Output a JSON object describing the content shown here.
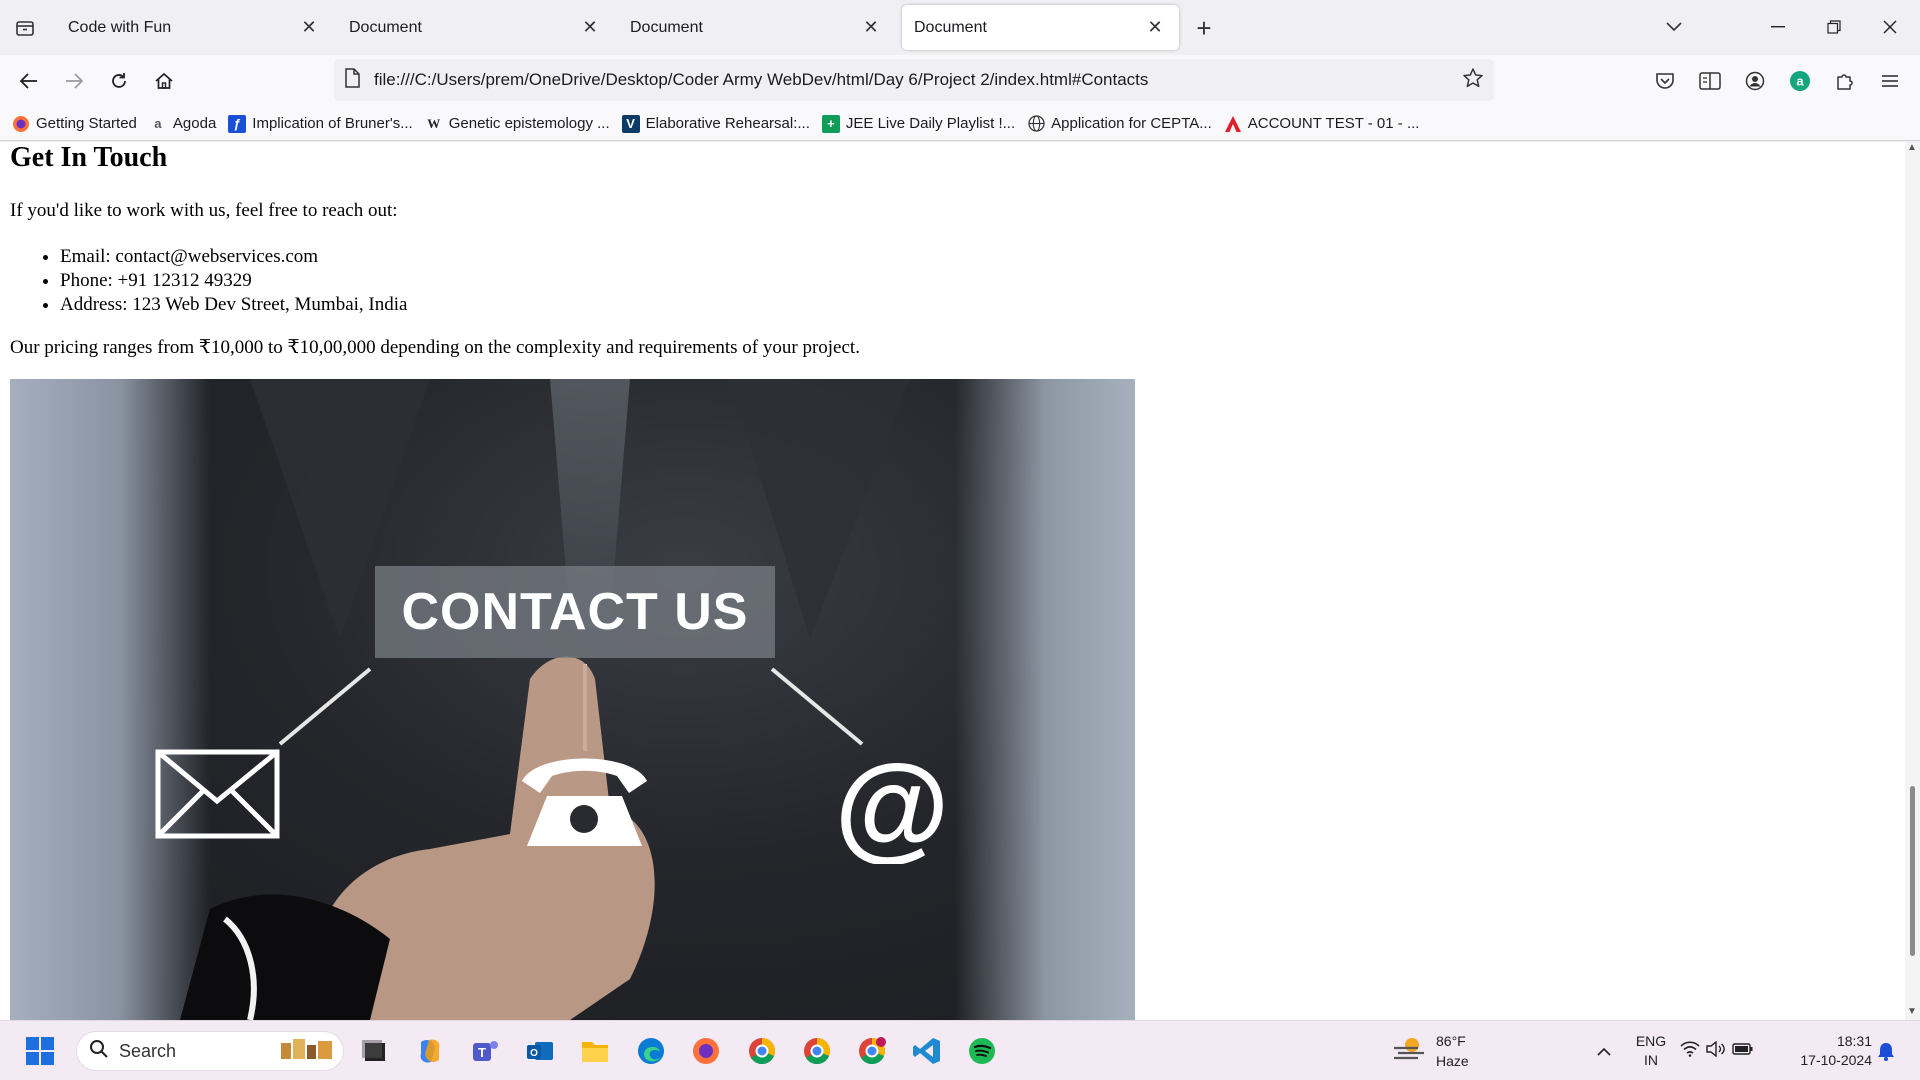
{
  "browser": {
    "tabs": [
      {
        "title": "Code with Fun",
        "active": false
      },
      {
        "title": "Document",
        "active": false
      },
      {
        "title": "Document",
        "active": false
      },
      {
        "title": "Document",
        "active": true
      }
    ],
    "url": "file:///C:/Users/prem/OneDrive/Desktop/Coder Army WebDev/html/Day 6/Project 2/index.html#Contacts",
    "bookmarks": [
      {
        "label": "Getting Started",
        "icon": "firefox-icon"
      },
      {
        "label": "Agoda",
        "icon": "agoda-icon"
      },
      {
        "label": "Implication of Bruner's...",
        "icon": "document-icon"
      },
      {
        "label": "Genetic epistemology ...",
        "icon": "wikipedia-icon"
      },
      {
        "label": "Elaborative Rehearsal:...",
        "icon": "v-icon"
      },
      {
        "label": "JEE Live Daily Playlist !...",
        "icon": "sheets-icon"
      },
      {
        "label": "Application for CEPTA...",
        "icon": "globe-icon"
      },
      {
        "label": "ACCOUNT TEST - 01 - ...",
        "icon": "a-red-icon"
      }
    ],
    "accent": "#0060df"
  },
  "page": {
    "heading": "Get In Touch",
    "intro": "If you'd like to work with us, feel free to reach out:",
    "contacts": [
      "Email: contact@webservices.com",
      "Phone: +91 12312 49329",
      "Address: 123 Web Dev Street, Mumbai, India"
    ],
    "pricing": "Our pricing ranges from ₹10,000 to ₹10,00,000 depending on the complexity and requirements of your project.",
    "image_caption": "CONTACT US"
  },
  "taskbar": {
    "search_label": "Search",
    "weather_temp": "86°F",
    "weather_desc": "Haze",
    "lang_line1": "ENG",
    "lang_line2": "IN",
    "time": "18:31",
    "date": "17-10-2024"
  }
}
